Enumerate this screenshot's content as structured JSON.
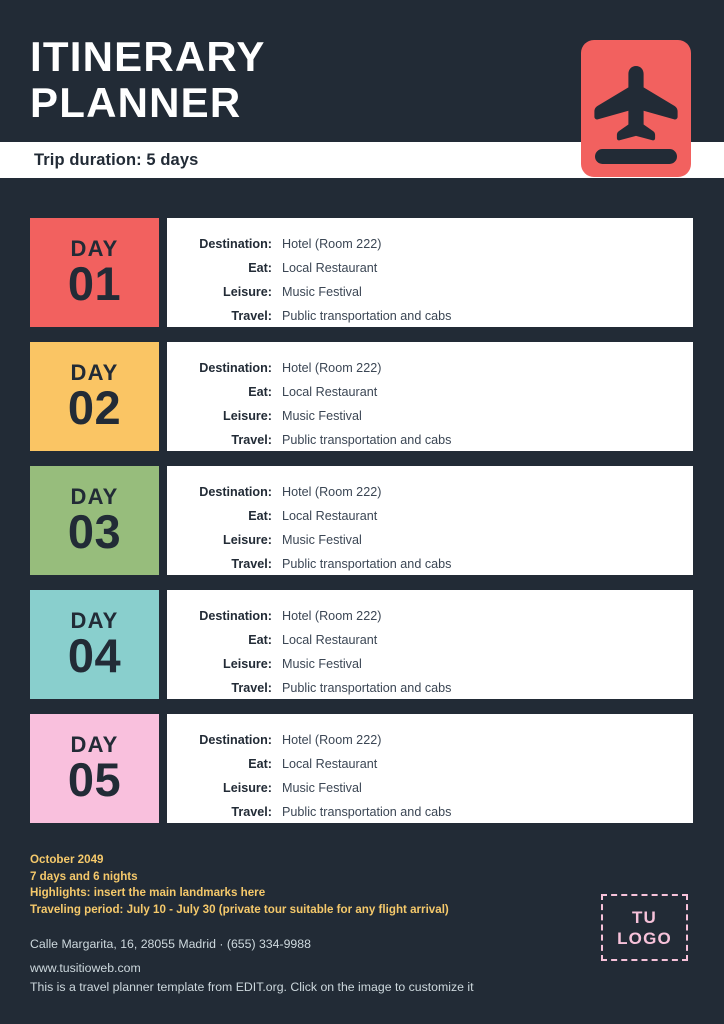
{
  "page": {
    "background_color": "#222b36"
  },
  "header": {
    "title_line1": "ITINERARY",
    "title_line2": "PLANNER",
    "duration_text": "Trip duration: 5 days",
    "icon": "passport-plane-icon",
    "icon_color": "#f2615f",
    "bar_background": "#ffffff"
  },
  "labels": {
    "destination": "Destination:",
    "eat": "Eat:",
    "leisure": "Leisure:",
    "travel": "Travel:"
  },
  "days": [
    {
      "word": "DAY",
      "number": "01",
      "color": "#f2615f",
      "destination": "Hotel (Room 222)",
      "eat": "Local Restaurant",
      "leisure": "Music Festival",
      "travel": "Public transportation and cabs"
    },
    {
      "word": "DAY",
      "number": "02",
      "color": "#fac564",
      "destination": "Hotel (Room 222)",
      "eat": "Local Restaurant",
      "leisure": "Music Festival",
      "travel": "Public transportation and cabs"
    },
    {
      "word": "DAY",
      "number": "03",
      "color": "#97bd7c",
      "destination": "Hotel (Room 222)",
      "eat": "Local Restaurant",
      "leisure": "Music Festival",
      "travel": "Public transportation and cabs"
    },
    {
      "word": "DAY",
      "number": "04",
      "color": "#89cfcd",
      "destination": "Hotel (Room 222)",
      "eat": "Local Restaurant",
      "leisure": "Music Festival",
      "travel": "Public transportation and cabs"
    },
    {
      "word": "DAY",
      "number": "05",
      "color": "#f9c0dd",
      "destination": "Hotel (Room 222)",
      "eat": "Local Restaurant",
      "leisure": "Music Festival",
      "travel": "Public transportation and cabs"
    }
  ],
  "footer": {
    "notes": [
      "October 2049",
      "7 days and 6 nights",
      "Highlights: insert the main landmarks here",
      "Traveling period: July 10 - July 30 (private tour suitable for any flight arrival)"
    ],
    "notes_color": "#f5c96b",
    "address": "Calle Margarita, 16, 28055 Madrid · (655) 334-9988",
    "website": "www.tusitioweb.com",
    "contact_color": "#cdd8dd",
    "disclaimer": "This is a travel planner template from EDIT.org. Click on the image to customize it",
    "logo_line1": "TU",
    "logo_line2": "LOGO",
    "logo_color": "#f7c2da"
  }
}
